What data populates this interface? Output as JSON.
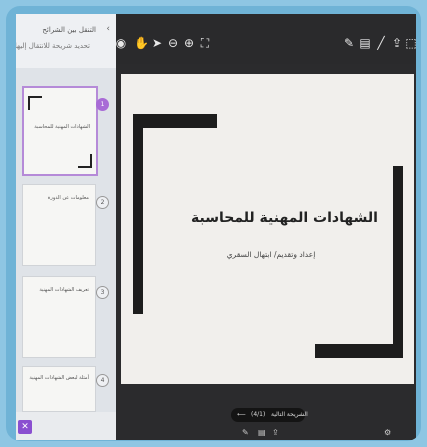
{
  "sidebar": {
    "title": "التنقل بين الشرائح",
    "subtitle": "تحديد شريحة للانتقال إليها",
    "slides": [
      {
        "number": "1",
        "text": "الشهادات المهنية للمحاسبة"
      },
      {
        "number": "2",
        "text": "معلومات عن الدورة"
      },
      {
        "number": "3",
        "text": "تعريف الشهادات المهنية"
      },
      {
        "number": "4",
        "text": "أمثلة لبعض الشهادات المهنية"
      }
    ]
  },
  "slide": {
    "title": "الشهادات المهنية للمحاسبة",
    "subtitle": "إعداد وتقديم/ ابتهال السقري"
  },
  "bottom_bar": {
    "label": "الشريحة التالية",
    "counter": "(4/1)"
  },
  "colors": {
    "accent": "#8a4fd0",
    "frame": "#6fb3d6",
    "slide_bg": "#f1efec"
  },
  "icons": [
    "circle-icon",
    "hand-icon",
    "pointer-icon",
    "zoom-out-icon",
    "zoom-in-icon",
    "fit-icon",
    "pen-icon",
    "slides-icon",
    "line-icon",
    "share-icon",
    "fullscreen-icon"
  ]
}
